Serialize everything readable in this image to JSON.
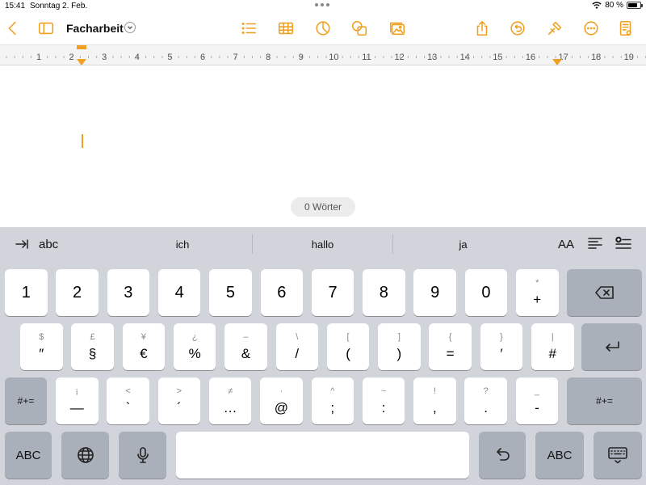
{
  "status": {
    "time": "15:41",
    "date": "Sonntag 2. Feb.",
    "battery": "80 %",
    "battery_level": 0.8
  },
  "toolbar": {
    "title": "Facharbeit",
    "icons": [
      "back-chevron-icon",
      "sidebar-icon",
      "list-icon",
      "table-icon",
      "chart-icon",
      "shapes-icon",
      "media-icon",
      "share-icon",
      "undo-icon",
      "format-brush-icon",
      "more-icon",
      "document-icon"
    ]
  },
  "ruler": {
    "numbers": [
      "1",
      "2",
      "3",
      "4",
      "5",
      "6",
      "7",
      "8",
      "9",
      "10",
      "11",
      "12",
      "13",
      "14",
      "15",
      "16",
      "17",
      "18",
      "19"
    ]
  },
  "document": {
    "word_count": "0 Wörter"
  },
  "keyboard": {
    "predictions": {
      "tab_label": "abc",
      "words": [
        "ich",
        "hallo",
        "ja"
      ],
      "text_size_label": "AA"
    },
    "row1": [
      {
        "main": "1"
      },
      {
        "main": "2"
      },
      {
        "main": "3"
      },
      {
        "main": "4"
      },
      {
        "main": "5"
      },
      {
        "main": "6"
      },
      {
        "main": "7"
      },
      {
        "main": "8"
      },
      {
        "main": "9"
      },
      {
        "main": "0"
      },
      {
        "main": "+",
        "sub": "*"
      }
    ],
    "row2": [
      {
        "main": "″",
        "sub": "$"
      },
      {
        "main": "§",
        "sub": "£"
      },
      {
        "main": "€",
        "sub": "¥"
      },
      {
        "main": "%",
        "sub": "¿"
      },
      {
        "main": "&",
        "sub": "–"
      },
      {
        "main": "/",
        "sub": "\\"
      },
      {
        "main": "(",
        "sub": "["
      },
      {
        "main": ")",
        "sub": "]"
      },
      {
        "main": "=",
        "sub": "{"
      },
      {
        "main": "′",
        "sub": "}"
      },
      {
        "main": "#",
        "sub": "|"
      }
    ],
    "row3": [
      {
        "main": "—",
        "sub": "¡"
      },
      {
        "main": "`",
        "sub": "<"
      },
      {
        "main": "´",
        "sub": ">"
      },
      {
        "main": "…",
        "sub": "≠"
      },
      {
        "main": "@",
        "sub": "·"
      },
      {
        "main": ";",
        "sub": "^"
      },
      {
        "main": ":",
        "sub": "~"
      },
      {
        "main": ",",
        "sub": "!"
      },
      {
        "main": ".",
        "sub": "?"
      },
      {
        "main": "-",
        "sub": "_"
      }
    ],
    "shift_left": "#+=",
    "shift_right": "#+=",
    "abc_left": "ABC",
    "abc_right": "ABC"
  }
}
